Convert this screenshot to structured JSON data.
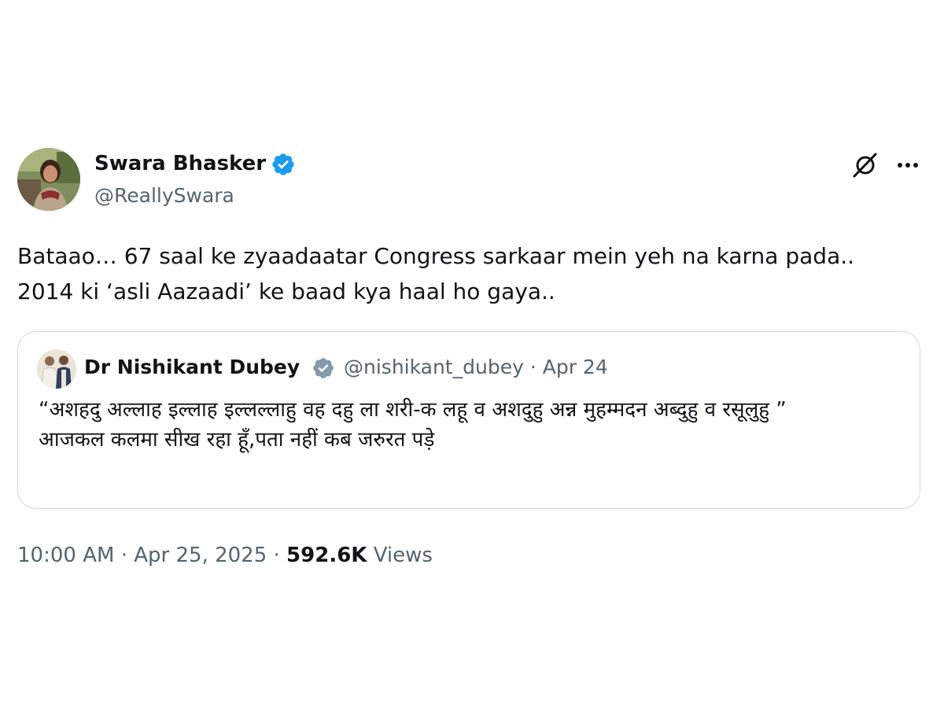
{
  "author": {
    "display_name": "Swara Bhasker",
    "handle": "@ReallySwara",
    "verified_color": "#1d9bf0"
  },
  "tweet": {
    "text": "Bataao… 67 saal ke zyaadaatar Congress sarkaar mein yeh na karna pada.. 2014 ki ‘asli Aazaadi’ ke baad kya haal ho gaya.."
  },
  "quoted_tweet": {
    "display_name": "Dr Nishikant Dubey",
    "handle": "@nishikant_dubey",
    "separator": "·",
    "date": "Apr 24",
    "verified_color": "#829aab",
    "lines": [
      "“अशहदु अल्लाह इल्लाह इल्लल्लाहु वह दहु ला शरी-क लहू व अशदुहु अन्न मुहम्मदन अब्दुहु व रसूलुहु ”",
      "आजकल कलमा सीख रहा हूँ,पता नहीं कब जरुरत पड़े"
    ]
  },
  "footer": {
    "time": "10:00 AM",
    "separator": "·",
    "date": "Apr 25, 2025",
    "views_count": "592.6K",
    "views_label": "Views"
  },
  "icons": {
    "grok": "grok-icon",
    "more": "more-options-icon",
    "verified": "verified-badge-icon"
  },
  "colors": {
    "text_primary": "#0f1419",
    "text_secondary": "#536471",
    "border": "#cfd9de"
  }
}
